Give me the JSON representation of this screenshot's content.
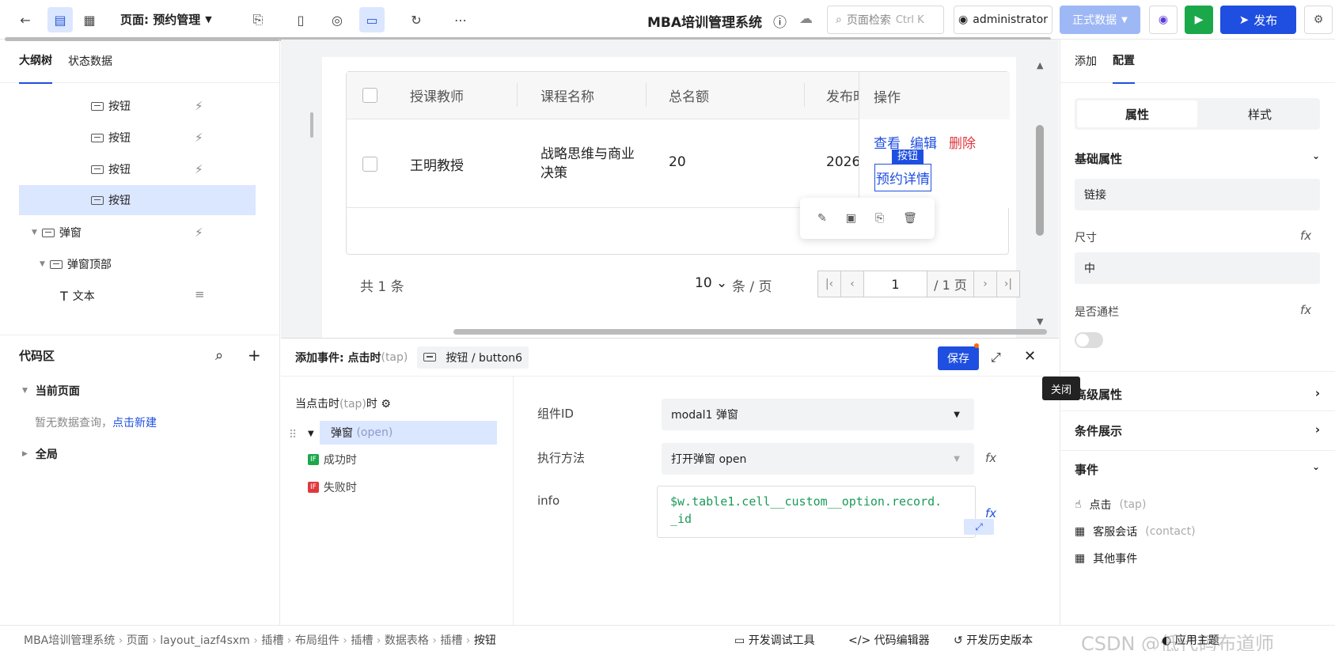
{
  "topbar": {
    "page_label": "页面: 预约管理",
    "system_title": "MBA培训管理系统",
    "search_placeholder": "页面检索",
    "search_shortcut": "Ctrl K",
    "user": "administrator",
    "data_env": "正式数据",
    "publish": "发布"
  },
  "left": {
    "tabs": [
      "大纲树",
      "状态数据"
    ],
    "tree": [
      {
        "label": "按钮"
      },
      {
        "label": "按钮"
      },
      {
        "label": "按钮"
      },
      {
        "label": "按钮"
      },
      {
        "label": "弹窗"
      },
      {
        "label": "弹窗顶部"
      },
      {
        "label": "文本"
      }
    ],
    "code_area": "代码区",
    "current_page": "当前页面",
    "empty_query": "暂无数据查询，",
    "new_link": "点击新建",
    "global": "全局"
  },
  "table": {
    "columns": [
      "授课教师",
      "课程名称",
      "总名额",
      "发布时",
      "操作"
    ],
    "row": {
      "teacher": "王明教授",
      "course_l1": "战略思维与商业",
      "course_l2": "决策",
      "quota": "20",
      "date": "2026-"
    },
    "actions": {
      "view": "查看",
      "edit": "编辑",
      "delete": "删除",
      "detail": "预约详情",
      "badge": "按钮"
    },
    "total": "共 1 条",
    "page_size": "10",
    "per_page": "条 / 页",
    "page_num": "1",
    "page_total": "/ 1 页"
  },
  "event": {
    "title": "添加事件: 点击时",
    "title_suffix": "(tap)",
    "tag": "按钮 / button6",
    "save": "保存",
    "trigger_prefix": "当点击时",
    "trigger_tap": "(tap)",
    "trigger_suffix": "时",
    "action_label": "弹窗",
    "action_suffix": "(open)",
    "success": "成功时",
    "fail": "失败时",
    "if_badge": "IF",
    "component_id_label": "组件ID",
    "component_id_value": "modal1 弹窗",
    "method_label": "执行方法",
    "method_value": "打开弹窗 open",
    "info_label": "info",
    "info_line1": "$w.table1.cell__custom__option.record.",
    "info_line2": "_id"
  },
  "right": {
    "tabs": [
      "添加",
      "配置"
    ],
    "seg": [
      "属性",
      "样式"
    ],
    "basic": "基础属性",
    "link_value": "链接",
    "size_label": "尺寸",
    "size_value": "中",
    "block_label": "是否通栏",
    "advanced": "高级属性",
    "conditional": "条件展示",
    "events": "事件",
    "ev_tap": "点击",
    "ev_tap_s": "(tap)",
    "ev_contact": "客服会话",
    "ev_contact_s": "(contact)",
    "ev_other": "其他事件",
    "tooltip_close": "关闭"
  },
  "footer": {
    "crumbs": [
      "MBA培训管理系统",
      "页面",
      "layout_iazf4sxm",
      "插槽",
      "布局组件",
      "插槽",
      "数据表格",
      "插槽",
      "按钮"
    ],
    "debug": "开发调试工具",
    "code_editor": "代码编辑器",
    "history": "开发历史版本",
    "watermark": "CSDN @低代码布道师",
    "theme": "应用主题"
  }
}
